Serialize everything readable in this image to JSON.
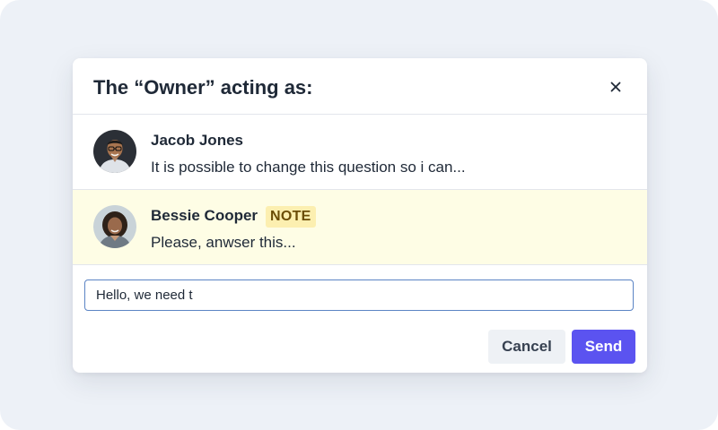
{
  "dialog": {
    "title": "The “Owner” acting as:",
    "close_icon": "close-icon"
  },
  "messages": [
    {
      "name": "Jacob Jones",
      "text": "It is possible to change this question so i can...",
      "avatar": "avatar-icon"
    },
    {
      "name": "Bessie Cooper",
      "badge": "NOTE",
      "text": "Please, anwser this...",
      "avatar": "avatar-icon"
    }
  ],
  "composer": {
    "value": "Hello, we need t",
    "placeholder": ""
  },
  "actions": {
    "cancel_label": "Cancel",
    "send_label": "Send"
  },
  "colors": {
    "background": "#edf1f7",
    "primary": "#5b53f0",
    "note_highlight": "#fefde5",
    "badge_bg": "#fcefb0",
    "input_border": "#5b84c4"
  }
}
